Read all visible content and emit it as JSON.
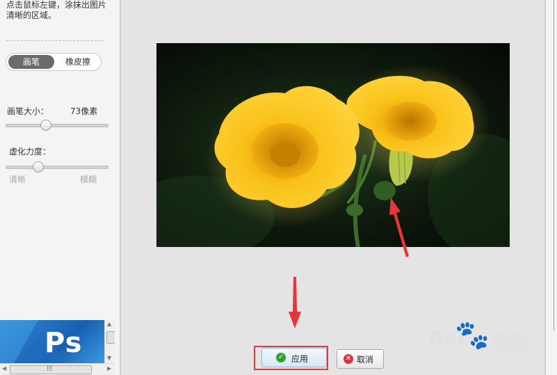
{
  "left_panel": {
    "instruction": "点击鼠标左键，涂抹出图片清晰的区域。",
    "mode_options": [
      "画笔",
      "橡皮擦"
    ],
    "selected_mode": "画笔",
    "brush_size_label": "画笔大小：",
    "brush_size_value": "73像素",
    "blur_label": "虚化力度：",
    "blur_min_label": "清晰",
    "blur_max_label": "模糊",
    "ad_text": "Ps"
  },
  "buttons": {
    "apply": "应用",
    "cancel": "取消"
  },
  "watermark": {
    "brand": "Bai",
    "exp": "经验",
    "url": "jingyan.baidu.com"
  },
  "colors": {
    "annotation": "#e8353a",
    "apply_icon": "#2fa12f",
    "cancel_icon": "#d9343a",
    "flower": "#f5b400"
  }
}
